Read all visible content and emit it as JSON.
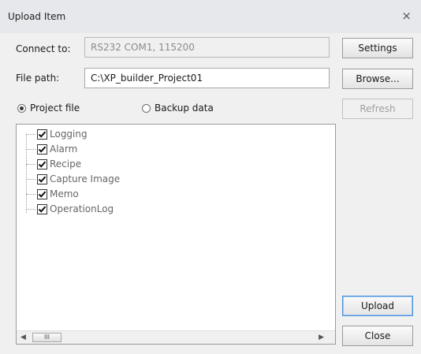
{
  "window": {
    "title": "Upload Item",
    "close_glyph": "×"
  },
  "connection": {
    "label": "Connect to:",
    "value": "RS232 COM1, 115200"
  },
  "file_path": {
    "label": "File path:",
    "value": "C:\\XP_builder_Project01"
  },
  "radios": {
    "project": {
      "label": "Project file",
      "checked": true
    },
    "backup": {
      "label": "Backup data",
      "checked": false
    }
  },
  "buttons": {
    "settings": "Settings",
    "browse": "Browse...",
    "refresh": "Refresh",
    "upload": "Upload",
    "close": "Close"
  },
  "tree_items": [
    {
      "label": "Logging",
      "checked": true
    },
    {
      "label": "Alarm",
      "checked": true
    },
    {
      "label": "Recipe",
      "checked": true
    },
    {
      "label": "Capture Image",
      "checked": true
    },
    {
      "label": "Memo",
      "checked": true
    },
    {
      "label": "OperationLog",
      "checked": true
    }
  ],
  "scrollbar": {
    "left_arrow": "◀",
    "right_arrow": "▶",
    "thumb_grip": "III"
  },
  "colors": {
    "title_bar": "#e6e8ec",
    "background": "#f0f0f0",
    "disabled_text": "#8c8c8c"
  }
}
